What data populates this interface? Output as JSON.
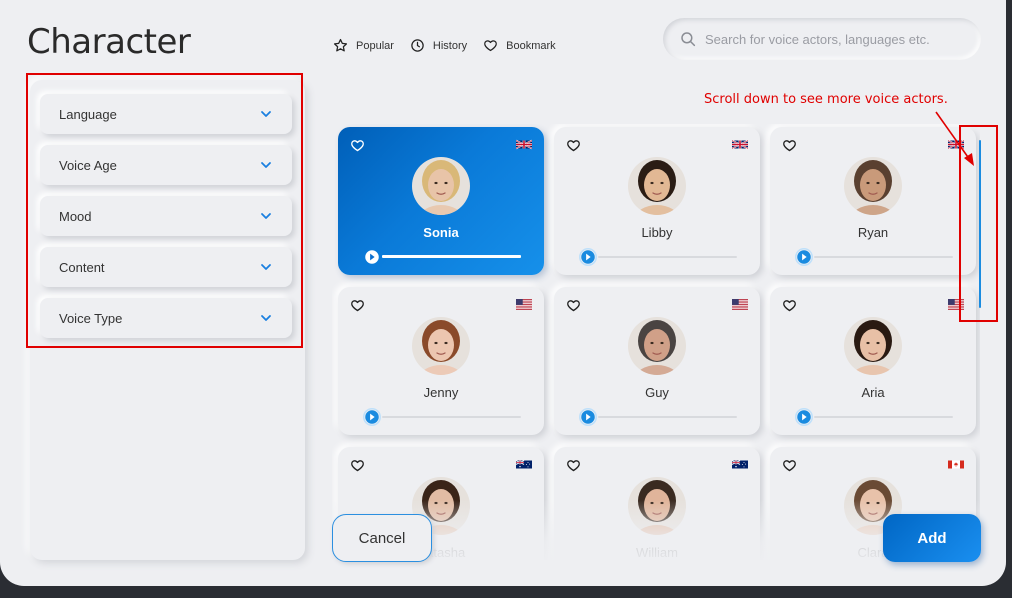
{
  "title": "Character",
  "nav": [
    {
      "label": "Popular",
      "icon": "star-icon"
    },
    {
      "label": "History",
      "icon": "clock-icon"
    },
    {
      "label": "Bookmark",
      "icon": "heart-icon"
    }
  ],
  "search": {
    "placeholder": "Search for voice actors, languages etc."
  },
  "filters": [
    {
      "label": "Language"
    },
    {
      "label": "Voice Age"
    },
    {
      "label": "Mood"
    },
    {
      "label": "Content"
    },
    {
      "label": "Voice Type"
    }
  ],
  "actors": [
    {
      "name": "Sonia",
      "flag": "uk",
      "selected": true,
      "progress": 0.95,
      "skin": "#e8c4a8",
      "hair": "#d9b878"
    },
    {
      "name": "Libby",
      "flag": "uk",
      "selected": false,
      "progress": 0,
      "skin": "#e2b894",
      "hair": "#2a1c14"
    },
    {
      "name": "Ryan",
      "flag": "uk",
      "selected": false,
      "progress": 0,
      "skin": "#c99a7a",
      "hair": "#5a4030"
    },
    {
      "name": "Jenny",
      "flag": "us",
      "selected": false,
      "progress": 0,
      "skin": "#ecc6b0",
      "hair": "#8a4a2a"
    },
    {
      "name": "Guy",
      "flag": "us",
      "selected": false,
      "progress": 0,
      "skin": "#d0a088",
      "hair": "#4a4442"
    },
    {
      "name": "Aria",
      "flag": "us",
      "selected": false,
      "progress": 0,
      "skin": "#e8c0a6",
      "hair": "#2a1a12"
    },
    {
      "name": "Natasha",
      "flag": "au",
      "selected": false,
      "progress": 0,
      "skin": "#e2bca4",
      "hair": "#3a2418"
    },
    {
      "name": "William",
      "flag": "au",
      "selected": false,
      "progress": 0,
      "skin": "#e0b49a",
      "hair": "#3a2a20"
    },
    {
      "name": "Clara",
      "flag": "ca",
      "selected": false,
      "progress": 0,
      "skin": "#e8c2aa",
      "hair": "#6a4a34"
    }
  ],
  "annotation": "Scroll down to see more voice actors.",
  "buttons": {
    "cancel": "Cancel",
    "add": "Add"
  },
  "colors": {
    "accent": "#0a7ad8",
    "annotation": "#e00000"
  }
}
